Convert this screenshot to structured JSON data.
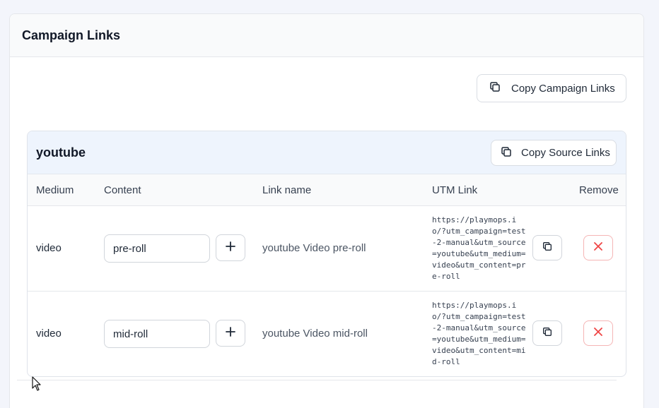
{
  "panel": {
    "title": "Campaign Links"
  },
  "copy_campaign": {
    "label": "Copy Campaign Links",
    "icon": "copy-icon"
  },
  "source": {
    "title": "youtube",
    "copy_label": "Copy Source Links",
    "columns": {
      "medium": "Medium",
      "content": "Content",
      "link_name": "Link name",
      "utm_link": "UTM Link",
      "remove": "Remove"
    },
    "rows": [
      {
        "medium": "video",
        "content": "pre-roll",
        "link_name": "youtube Video pre-roll",
        "utm": "https://playmops.io/?utm_campaign=test-2-manual&utm_source=youtube&utm_medium=video&utm_content=pre-roll"
      },
      {
        "medium": "video",
        "content": "mid-roll",
        "link_name": "youtube Video mid-roll",
        "utm": "https://playmops.io/?utm_campaign=test-2-manual&utm_source=youtube&utm_medium=video&utm_content=mid-roll"
      }
    ]
  },
  "colors": {
    "remove_accent": "#ef4444",
    "source_header_bg": "#eef4fd",
    "page_bg": "#f3f5fb"
  }
}
